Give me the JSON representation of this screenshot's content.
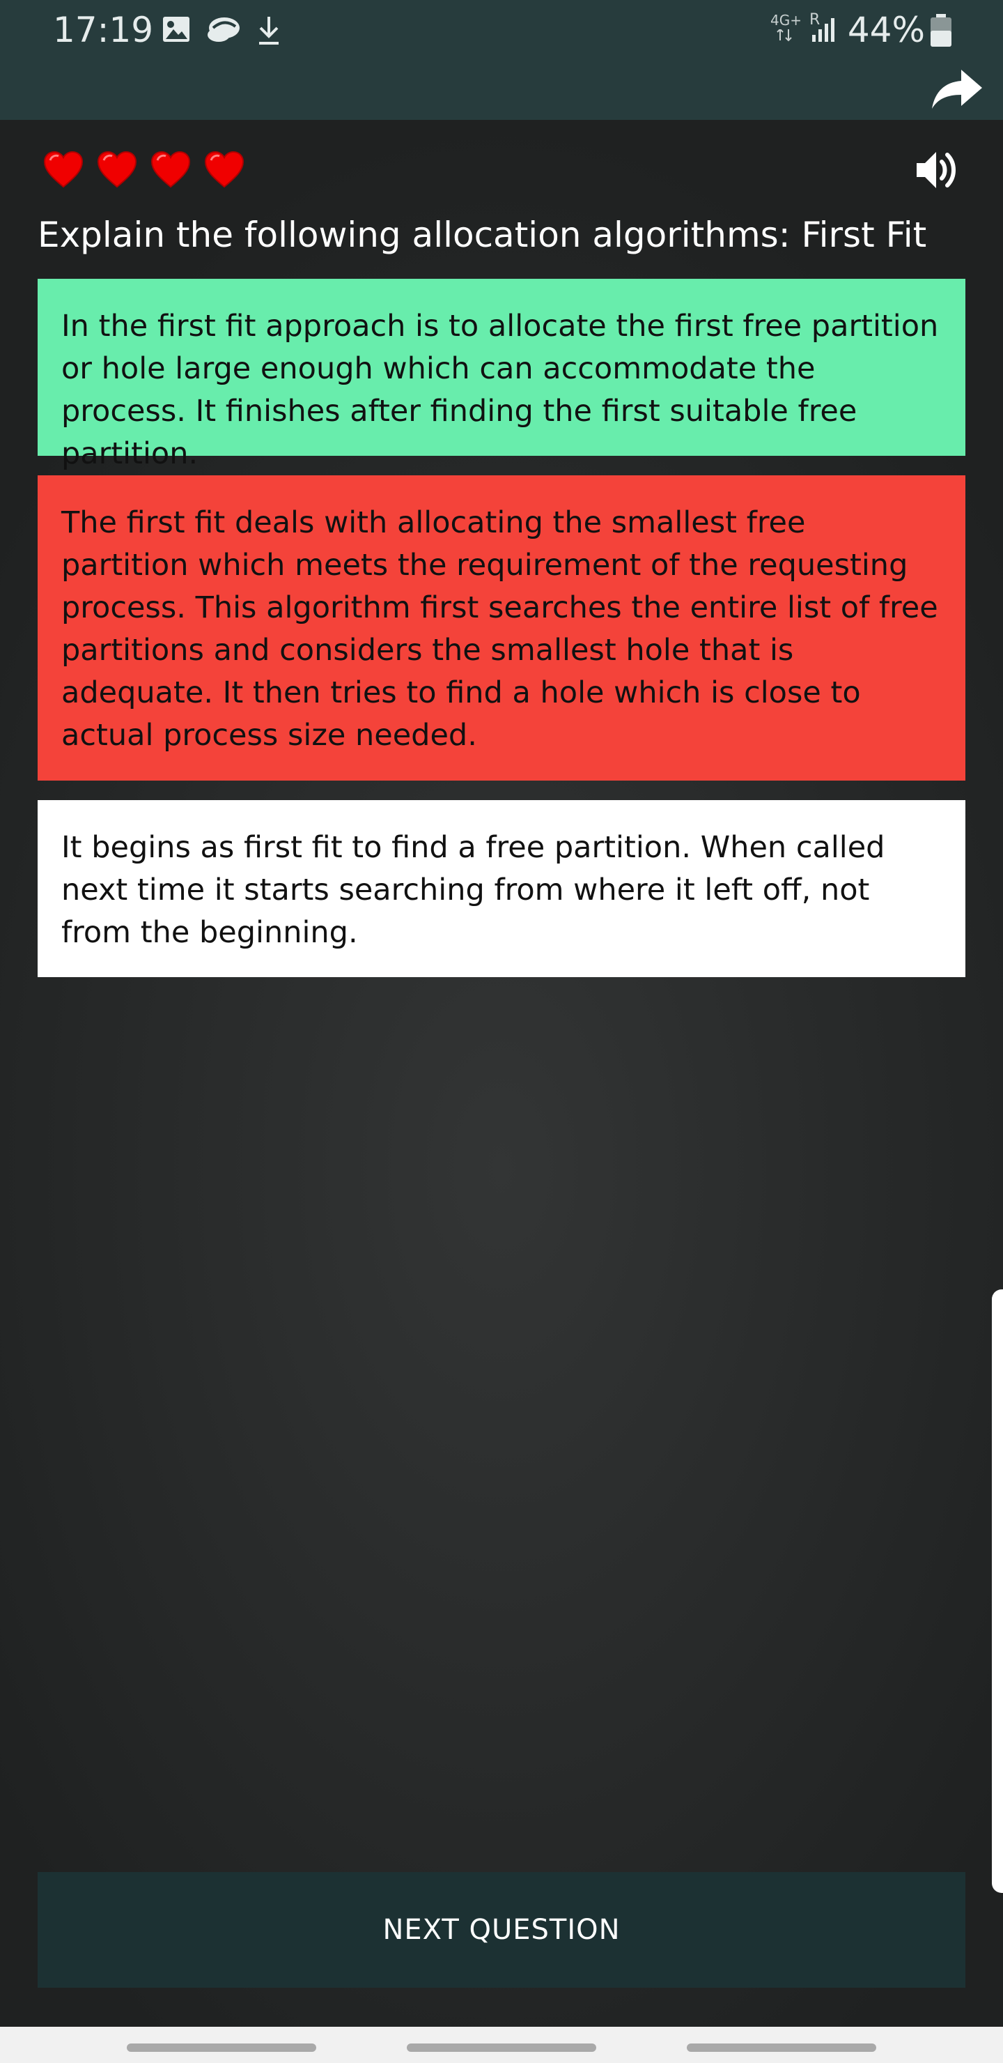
{
  "status_bar": {
    "time": "17:19",
    "network_label": "4G+",
    "roaming_label": "R",
    "battery": "44%",
    "icons": [
      "image-icon",
      "cloud-sync-icon",
      "download-icon",
      "signal-icon",
      "battery-icon"
    ]
  },
  "toolbar": {
    "share_icon": "share-icon"
  },
  "game": {
    "lives": 4,
    "heart_icon": "heart-icon",
    "sound_icon": "speaker-icon"
  },
  "question": {
    "text": "Explain the following allocation algorithms: First Fit"
  },
  "answers": [
    {
      "text": "In the first fit approach is to allocate the first free partition or hole large enough which can accommodate the process. It finishes after finding the first suitable free partition.",
      "state": "correct",
      "color": "#68edac"
    },
    {
      "text": "The first fit deals with allocating the smallest free partition which meets the requirement of the requesting process. This algorithm first searches the entire list of free partitions and considers the smallest hole that is adequate. It then tries to find a hole which is close to actual process size needed.",
      "state": "wrong",
      "color": "#f4433a"
    },
    {
      "text": "It begins as first fit to find a free partition. When called next time it starts searching from where it left off, not from the beginning.",
      "state": "neutral",
      "color": "#ffffff"
    }
  ],
  "next_button": {
    "label": "NEXT QUESTION"
  },
  "colors": {
    "toolbar": "#273c3d",
    "background": "#2a2c2c",
    "next_button": "#1c3133",
    "heart": "#f00000"
  }
}
